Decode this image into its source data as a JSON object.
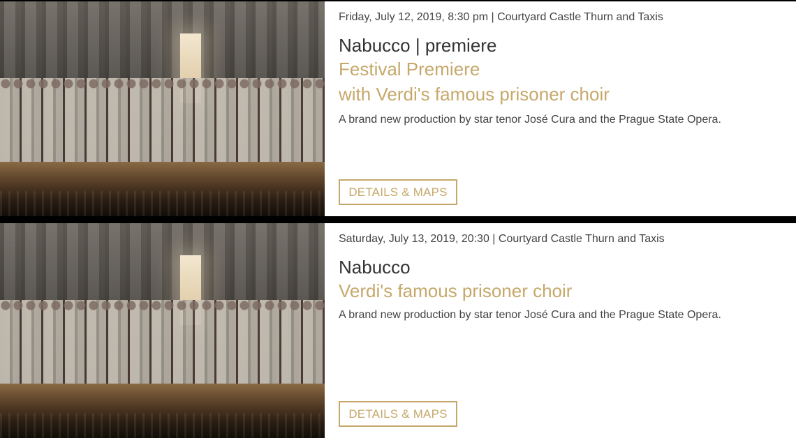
{
  "events": [
    {
      "date": "Friday, July 12, 2019, 8:30 pm | Courtyard Castle Thurn and Taxis",
      "title": "Nabucco | premiere",
      "subtitle_lines": [
        "Festival Premiere",
        "with Verdi's famous prisoner choir"
      ],
      "description": "A brand new production by star tenor José Cura and the Prague State Opera.",
      "button_label": "DETAILS & MAPS"
    },
    {
      "date": "Saturday, July 13, 2019, 20:30 | Courtyard Castle Thurn and Taxis",
      "title": "Nabucco",
      "subtitle_lines": [
        "Verdi's famous prisoner choir"
      ],
      "description": "A brand new production by star tenor José Cura and the Prague State Opera.",
      "button_label": "DETAILS & MAPS"
    }
  ],
  "colors": {
    "accent": "#c6a86b",
    "text": "#333333",
    "background": "#ffffff",
    "separator": "#000000"
  }
}
